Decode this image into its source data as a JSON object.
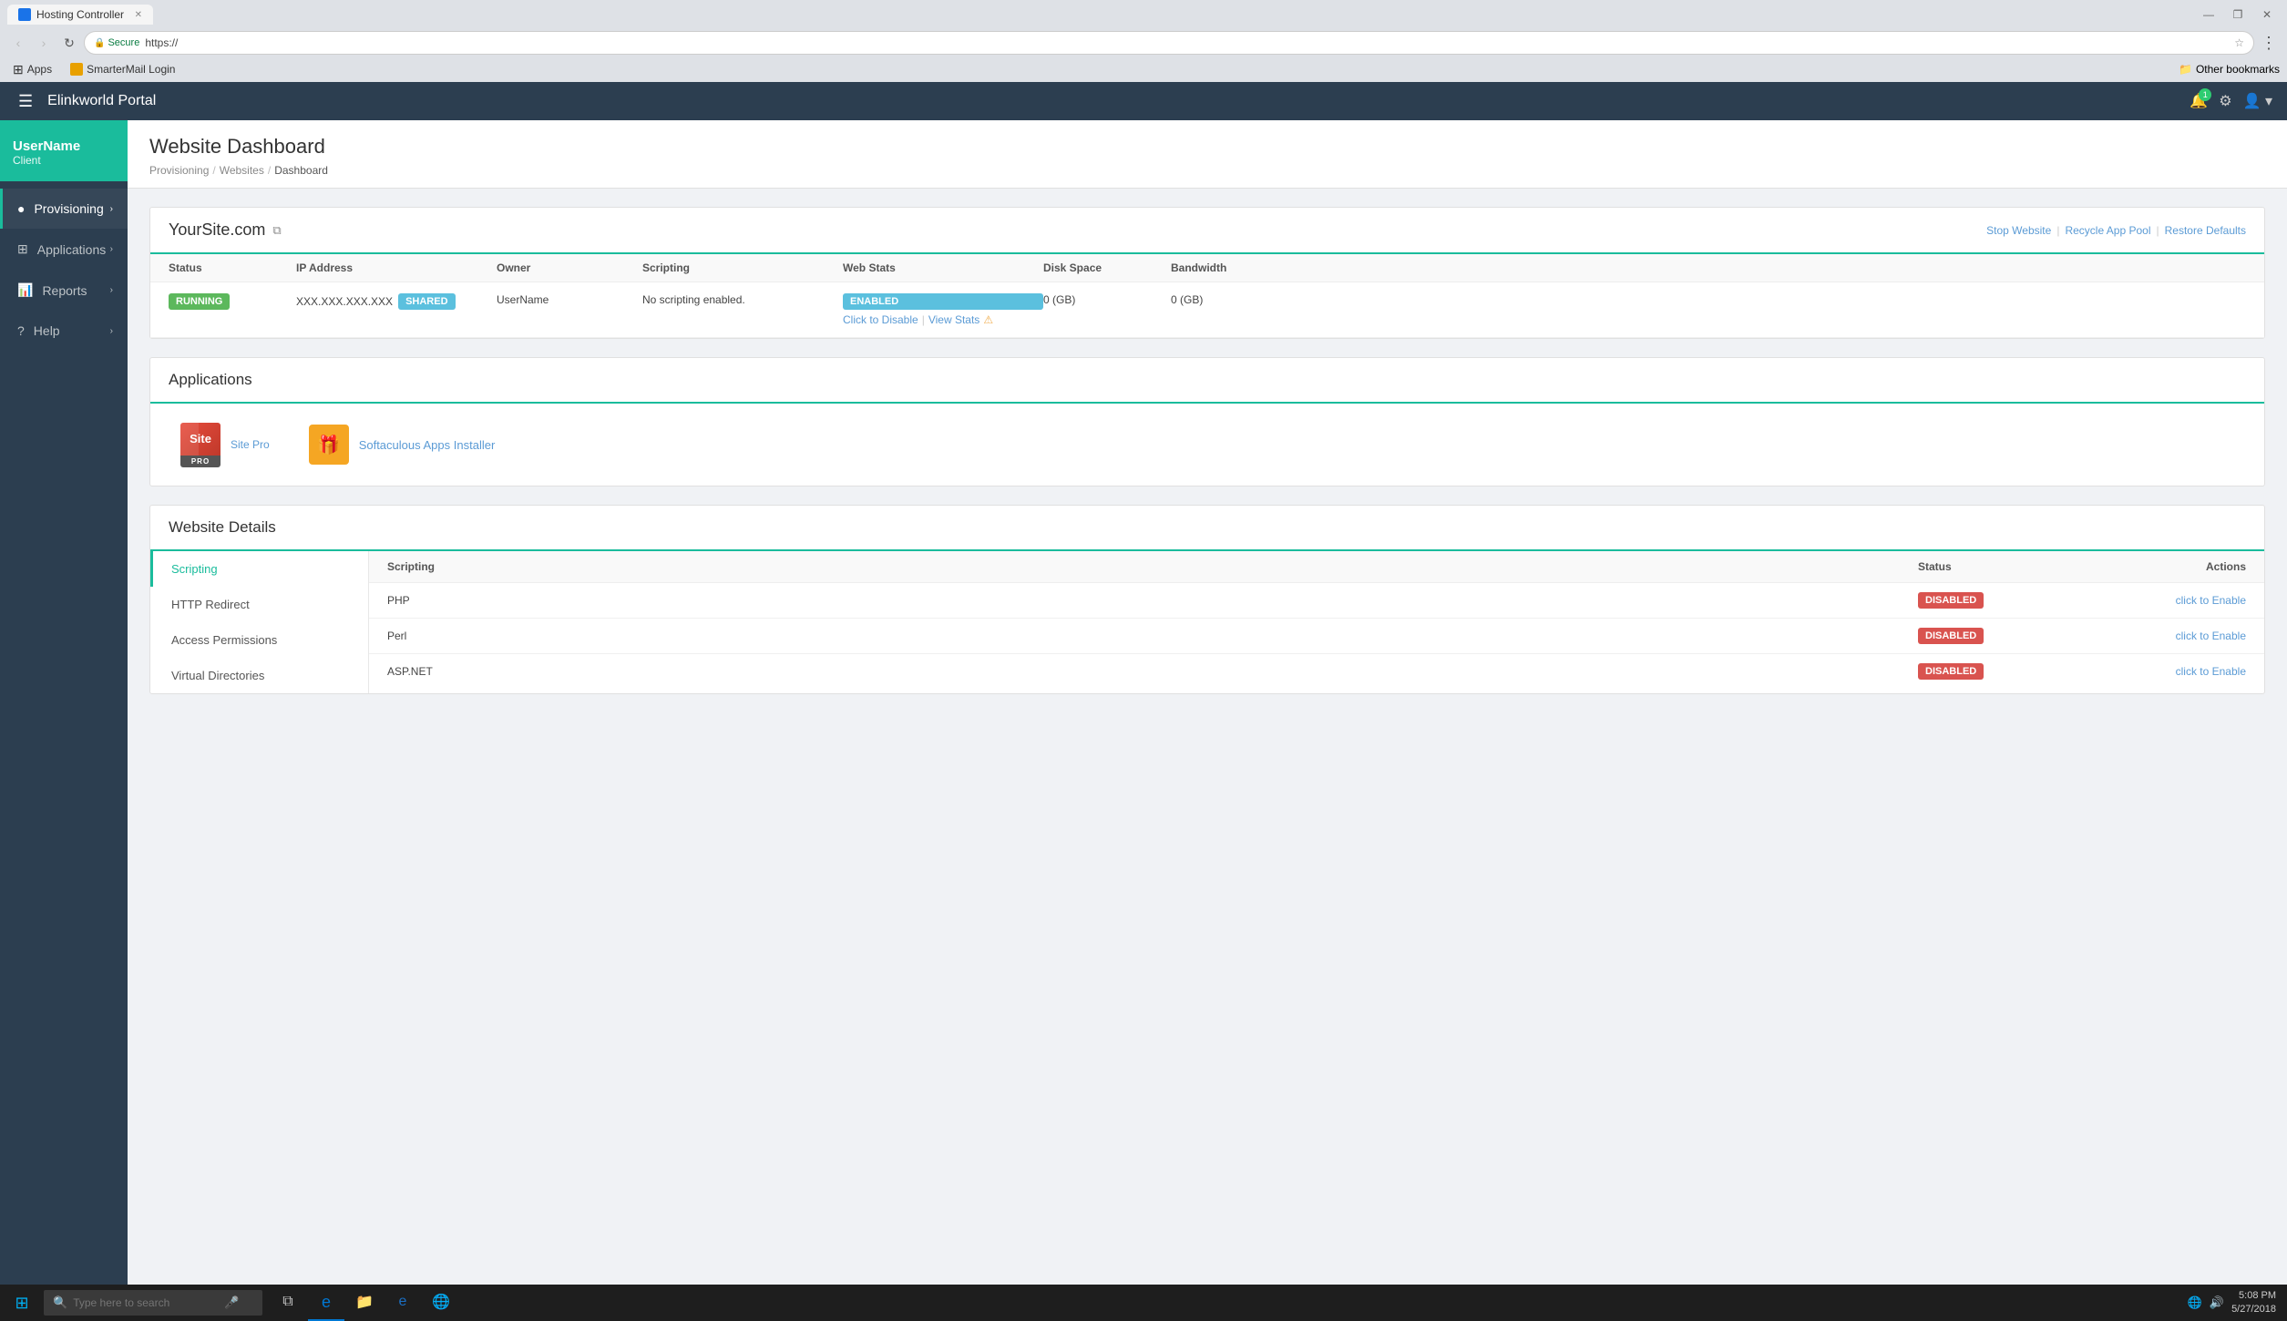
{
  "browser": {
    "tab_title": "Hosting Controller",
    "tab_icon": "browser-tab-icon",
    "address_secure_label": "Secure",
    "address_url": "https://",
    "other_bookmarks_label": "Other bookmarks"
  },
  "bookmarks": {
    "apps_label": "Apps",
    "smartermail_label": "SmarterMail Login"
  },
  "topnav": {
    "portal_name": "Elinkworld Portal",
    "notification_count": "1"
  },
  "sidebar": {
    "user_name": "UserName",
    "user_role": "Client",
    "items": [
      {
        "label": "Provisioning",
        "icon": "●"
      },
      {
        "label": "Applications",
        "icon": "⊞"
      },
      {
        "label": "Reports",
        "icon": "📊"
      },
      {
        "label": "Help",
        "icon": "?"
      }
    ]
  },
  "page": {
    "title": "Website Dashboard",
    "breadcrumbs": [
      {
        "label": "Provisioning"
      },
      {
        "label": "Websites"
      },
      {
        "label": "Dashboard"
      }
    ]
  },
  "site": {
    "name": "YourSite.com",
    "actions": {
      "stop": "Stop Website",
      "recycle": "Recycle App Pool",
      "restore": "Restore Defaults"
    },
    "table": {
      "headers": [
        "Status",
        "IP Address",
        "Owner",
        "Scripting",
        "Web Stats",
        "Disk Space",
        "Bandwidth"
      ],
      "row": {
        "status": "Running",
        "ip_address": "XXX.XXX.XXX.XXX",
        "ip_type": "Shared",
        "owner": "UserName",
        "scripting": "No scripting enabled.",
        "webstats_badge": "Enabled",
        "webstats_disable": "Click to Disable",
        "webstats_view": "View Stats",
        "disk_space": "0 (GB)",
        "bandwidth": "0 (GB)"
      }
    }
  },
  "applications": {
    "title": "Applications",
    "items": [
      {
        "name": "Site Pro",
        "type": "sitepro"
      },
      {
        "name": "Softaculous Apps Installer",
        "type": "softaculous"
      }
    ]
  },
  "website_details": {
    "title": "Website Details",
    "nav_items": [
      "Scripting",
      "HTTP Redirect",
      "Access Permissions",
      "Virtual Directories"
    ],
    "active_nav": "Scripting",
    "scripting_table": {
      "headers": [
        "Scripting",
        "Status",
        "Actions"
      ],
      "rows": [
        {
          "name": "PHP",
          "status": "Disabled",
          "action": "click to Enable"
        },
        {
          "name": "Perl",
          "status": "Disabled",
          "action": "click to Enable"
        },
        {
          "name": "ASP.NET",
          "status": "Disabled",
          "action": "click to Enable"
        }
      ]
    }
  },
  "taskbar": {
    "search_placeholder": "Type here to search",
    "time": "5:08 PM",
    "date": "5/27/2018"
  }
}
